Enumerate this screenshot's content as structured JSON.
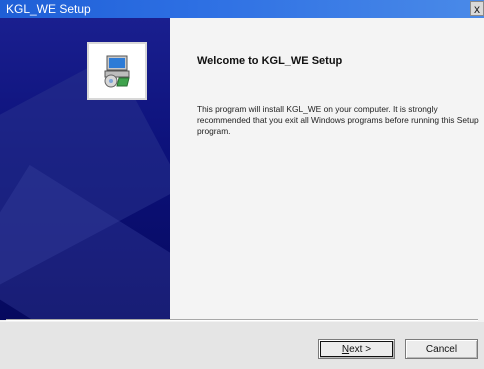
{
  "window": {
    "title": "KGL_WE Setup",
    "close_label": "x"
  },
  "welcome": {
    "title": "Welcome to KGL_WE Setup",
    "text": "This program will install KGL_WE on your computer. It is strongly recommended that you exit all Windows programs before running this Setup program."
  },
  "buttons": {
    "next_mnemonic": "N",
    "next_rest": "ext >",
    "cancel": "Cancel"
  },
  "colors": {
    "titlebar": "#2d6fe3",
    "left_panel": "#0c117a"
  },
  "icons": {
    "setup": "setup-computer-icon"
  }
}
